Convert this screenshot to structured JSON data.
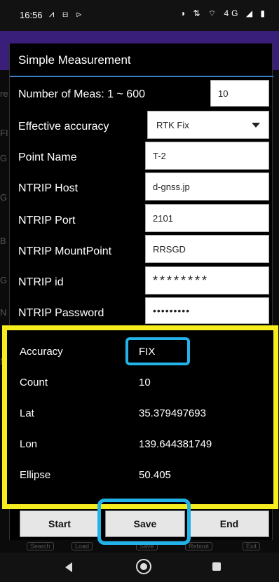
{
  "status_bar": {
    "time": "16:56",
    "left_icons": [
      "notification-icon",
      "message-icon",
      "play-icon"
    ],
    "left_glyphs": "⩘ ⊟ ⊳",
    "right_glyphs": "◑ ⇅ ⌔ 4G ◢ ▮",
    "right_icons": [
      "vibrate-icon",
      "data-icon",
      "wifi-icon",
      "4g-icon",
      "signal-icon",
      "battery-icon"
    ]
  },
  "dialog": {
    "title": "Simple Measurement",
    "fields": {
      "num_meas_label": "Number of Meas: 1 ~ 600",
      "num_meas_value": "10",
      "effective_accuracy_label": "Effective accuracy",
      "effective_accuracy_value": "RTK Fix",
      "point_name_label": "Point Name",
      "point_name_value": "T-2",
      "ntrip_host_label": "NTRIP Host",
      "ntrip_host_value": "d-gnss.jp",
      "ntrip_port_label": "NTRIP Port",
      "ntrip_port_value": "2101",
      "ntrip_mountpoint_label": "NTRIP MountPoint",
      "ntrip_mountpoint_value": "RRSGD",
      "ntrip_id_label": "NTRIP id",
      "ntrip_id_value": "********",
      "ntrip_password_label": "NTRIP Password",
      "ntrip_password_value": "•••••••••"
    },
    "results": {
      "accuracy_label": "Accuracy",
      "accuracy_value": "FIX",
      "count_label": "Count",
      "count_value": "10",
      "lat_label": "Lat",
      "lat_value": "35.379497693",
      "lon_label": "Lon",
      "lon_value": "139.644381749",
      "ellipse_label": "Ellipse",
      "ellipse_value": "50.405"
    },
    "buttons": {
      "start": "Start",
      "save": "Save",
      "end": "End"
    }
  },
  "background_ghost_text": [
    "re",
    "FI",
    "G",
    "G",
    "B",
    "G",
    "N",
    "N"
  ],
  "background_toolbar": [
    "Search",
    "Load",
    "Save",
    "Reboot",
    "Exit"
  ],
  "colors": {
    "highlight_yellow": "#f6ed1f",
    "highlight_blue": "#22b3e8",
    "app_bar_purple": "#3a1f7a",
    "title_underline": "#3a83c8"
  }
}
